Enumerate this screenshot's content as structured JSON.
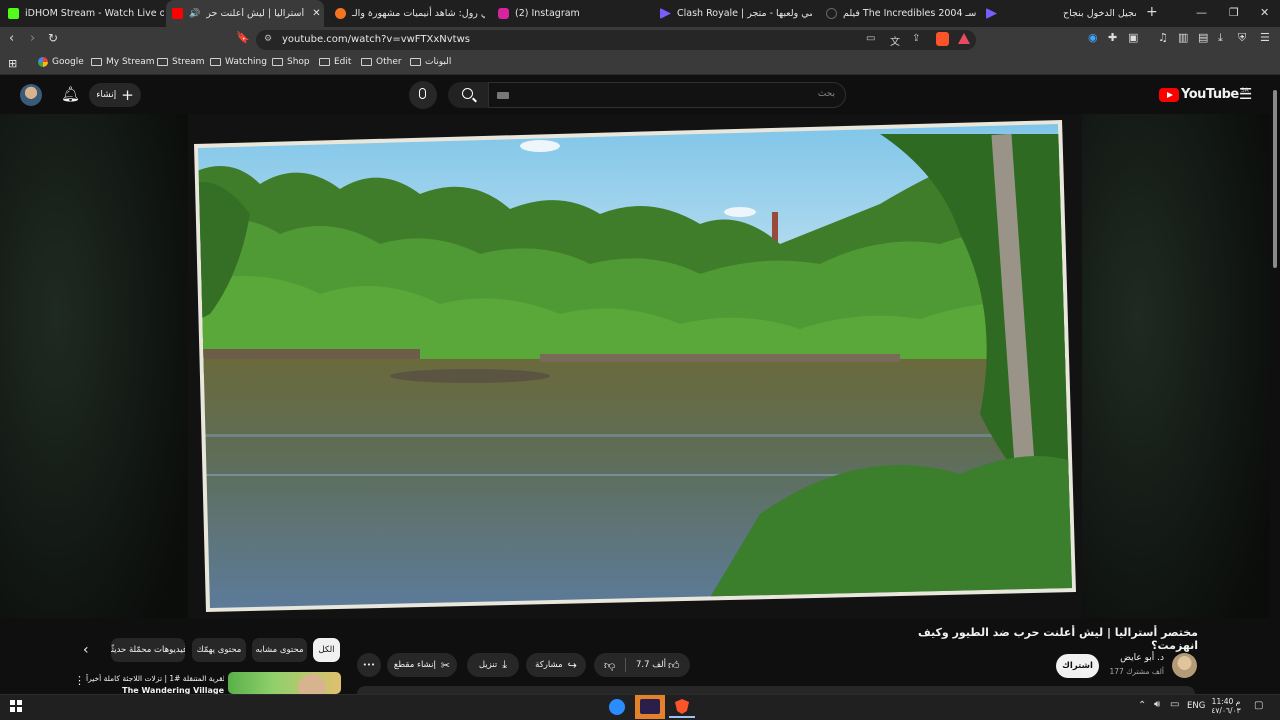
{
  "browser": {
    "tabs": [
      {
        "title": "iDHOM Stream - Watch Live on Kick",
        "fav_color": "#53fc18"
      },
      {
        "title": "مختصر أستراليا | ليش أعلنت حر...",
        "fav_color": "#ff0000",
        "active": true
      },
      {
        "title": "كرانشي رول: شاهد أنيميات مشهورة والـ",
        "fav_color": "#f47521"
      },
      {
        "title": "(2) Instagram",
        "fav_color": "#d6249f"
      },
      {
        "title": "Clash Royale | متجر ...ر شخصي ولعبها - متجر",
        "fav_color": "#7b5cff"
      },
      {
        "title": "فيلم The Incredibles 2004 مترجم - سـ",
        "fav_color": "#555555"
      },
      {
        "title": "تم تسجيل الدخول بنجاح",
        "fav_color": "#7b5cff"
      }
    ],
    "new_tab": "+",
    "url": "youtube.com/watch?v=vwFTXxNvtws",
    "bookmarks": [
      {
        "label": "Google",
        "type": "google"
      },
      {
        "label": "My Stream",
        "type": "folder"
      },
      {
        "label": "Stream",
        "type": "folder"
      },
      {
        "label": "Watching",
        "type": "folder"
      },
      {
        "label": "Shop",
        "type": "folder"
      },
      {
        "label": "Edit",
        "type": "folder"
      },
      {
        "label": "Other",
        "type": "folder"
      },
      {
        "label": "البونات",
        "type": "folder"
      }
    ]
  },
  "youtube": {
    "logo_text": "YouTube",
    "region": "SA",
    "search_placeholder": "بحث",
    "create_label": "إنشاء",
    "video": {
      "title": "مختصر أستراليا | ليش أعلنت حرب ضد الطيور وكيف انهزمت؟",
      "channel": "د. أبو عايض",
      "subscribers": "177 ألف مشترك",
      "subscribe_label": "اشتراك",
      "likes": "7.7 ألف",
      "share_label": "مشاركة",
      "download_label": "تنزيل",
      "clip_label": "إنشاء مقطع",
      "more_label": "•••"
    },
    "filters": [
      "الكل",
      "محتوى مشابه",
      "محتوى يهمّك",
      "فيديوهات محمّلة حديثًا"
    ],
    "recommended": {
      "title": "القرية المتنقلة #1 | تزلات اللاجئة كاملة أخيراً",
      "subtitle": "The Wandering Village"
    }
  },
  "taskbar": {
    "lang": "ENG",
    "time": "11:40 م",
    "date": "٤٧/٠٦/٠٣",
    "apps": [
      "nest",
      "next",
      "brave"
    ]
  },
  "colors": {
    "yt_red": "#ff0000",
    "bg": "#0f0f0f",
    "pill": "#272727"
  }
}
